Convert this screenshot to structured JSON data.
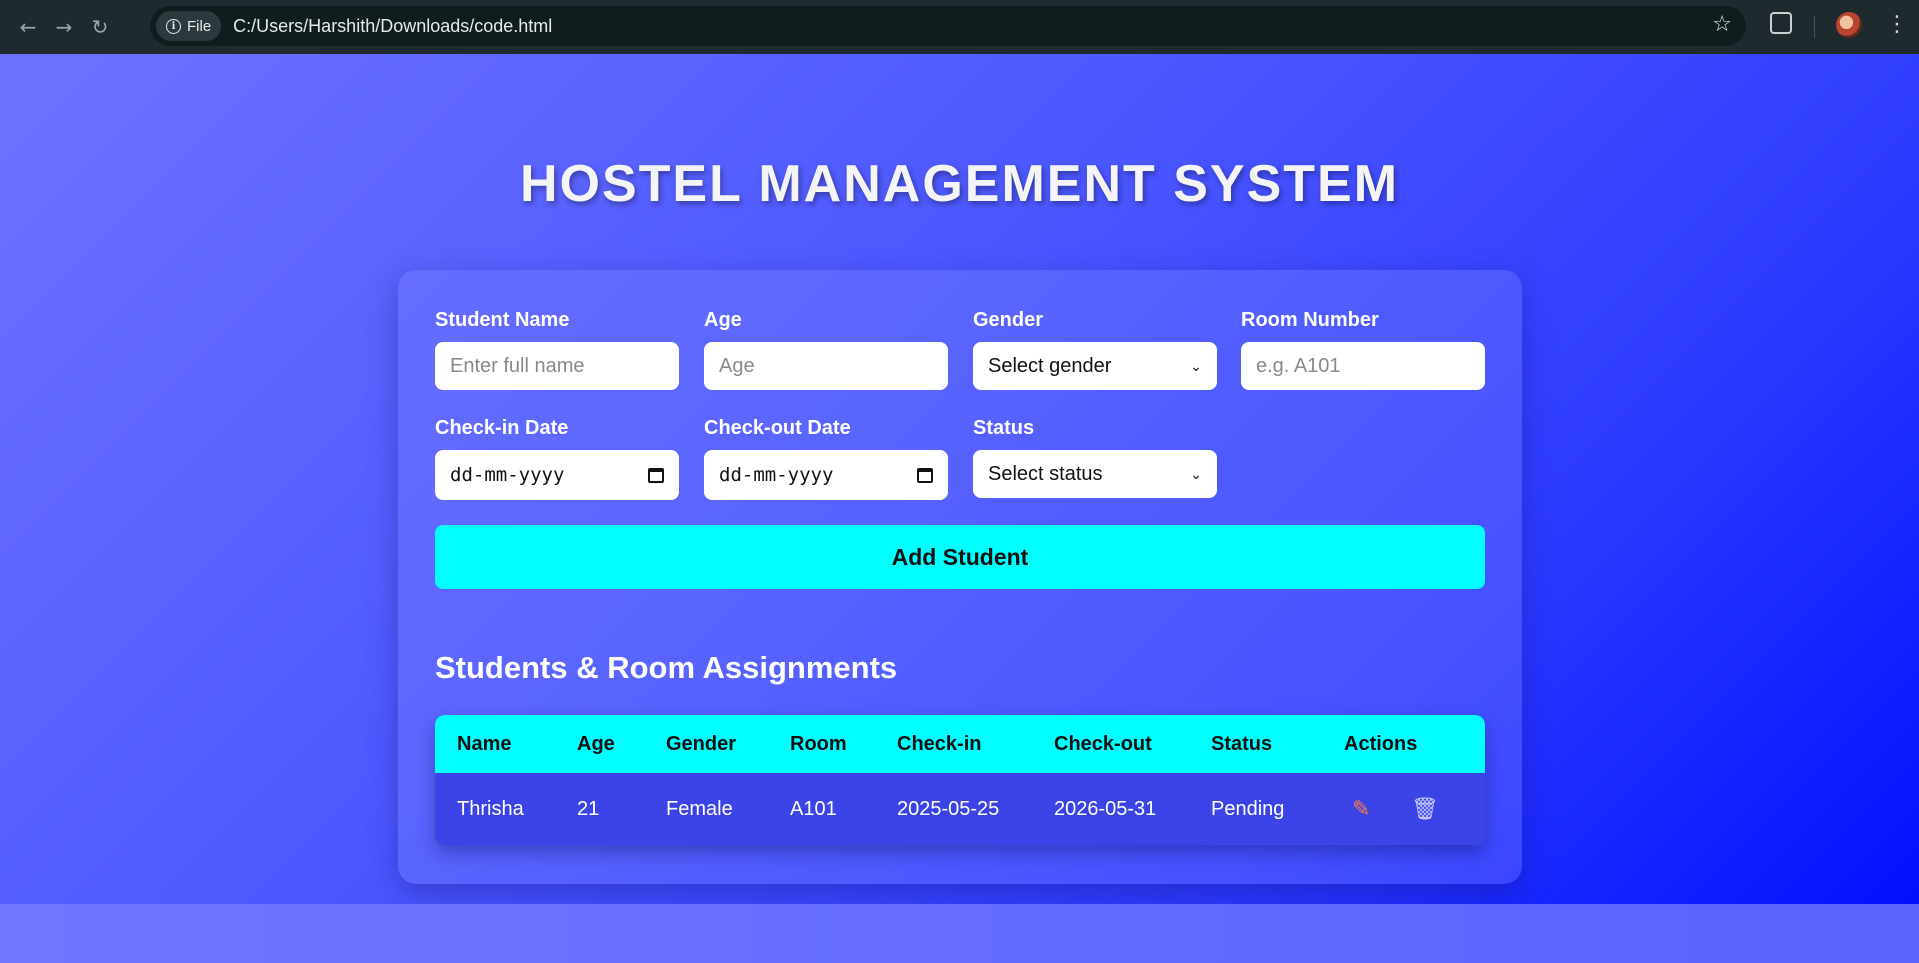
{
  "browser": {
    "file_chip": "File",
    "url": "C:/Users/Harshith/Downloads/code.html"
  },
  "page": {
    "title": "HOSTEL MANAGEMENT SYSTEM"
  },
  "form": {
    "student_name": {
      "label": "Student Name",
      "placeholder": "Enter full name"
    },
    "age": {
      "label": "Age",
      "placeholder": "Age"
    },
    "gender": {
      "label": "Gender",
      "selected": "Select gender"
    },
    "room_number": {
      "label": "Room Number",
      "placeholder": "e.g. A101"
    },
    "check_in": {
      "label": "Check-in Date",
      "value": "dd-mm-yyyy"
    },
    "check_out": {
      "label": "Check-out Date",
      "value": "dd-mm-yyyy"
    },
    "status": {
      "label": "Status",
      "selected": "Select status"
    },
    "submit_label": "Add Student"
  },
  "table": {
    "title": "Students & Room Assignments",
    "columns": [
      "Name",
      "Age",
      "Gender",
      "Room",
      "Check-in",
      "Check-out",
      "Status",
      "Actions"
    ],
    "rows": [
      [
        "Thrisha",
        "21",
        "Female",
        "A101",
        "2025-05-25",
        "2026-05-31",
        "Pending"
      ]
    ]
  },
  "icons": {
    "edit": "edit-icon",
    "delete": "trash-icon"
  },
  "colors": {
    "accent": "#00ffff",
    "edit_icon": "#ff7a3c",
    "background_start": "#6e72ff",
    "background_end": "#0010ff"
  }
}
